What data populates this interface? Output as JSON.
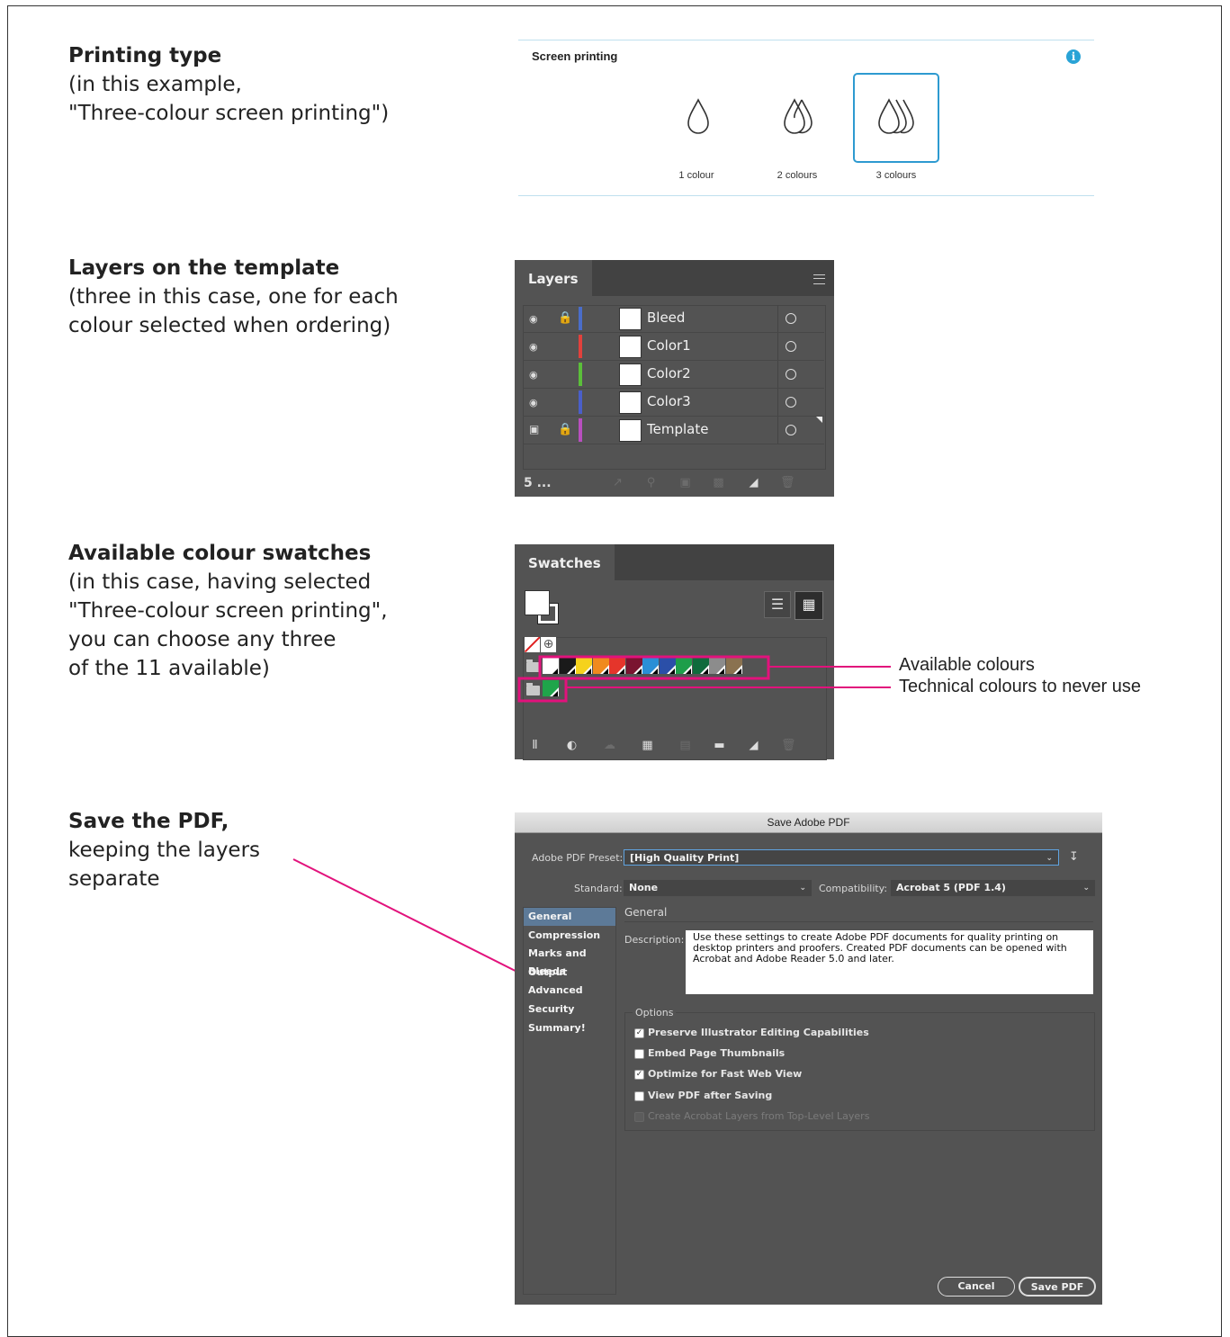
{
  "sections": [
    {
      "heading": "Printing type",
      "desc": "(in this example,\n\"Three-colour screen printing\")"
    },
    {
      "heading": "Layers on the template",
      "desc": "(three in this case, one for each\ncolour selected when ordering)"
    },
    {
      "heading": "Available colour swatches",
      "desc": "(in this case, having selected\n\"Three-colour screen printing\",\nyou can choose any three\nof the 11 available)"
    },
    {
      "heading": "Save the PDF,",
      "desc": "keeping the layers\nseparate"
    }
  ],
  "printing": {
    "title": "Screen printing",
    "info_icon": "i",
    "options": [
      {
        "label": "1 colour",
        "selected": false
      },
      {
        "label": "2 colours",
        "selected": false
      },
      {
        "label": "3 colours",
        "selected": true
      }
    ],
    "selection_color": "#2e9ad0"
  },
  "layers_panel": {
    "tab": "Layers",
    "count": "5 ...",
    "rows": [
      {
        "name": "Bleed",
        "color": "#4a6dc9",
        "visible": true,
        "locked": true
      },
      {
        "name": "Color1",
        "color": "#e2413c",
        "visible": true,
        "locked": false
      },
      {
        "name": "Color2",
        "color": "#5bbf3a",
        "visible": true,
        "locked": false
      },
      {
        "name": "Color3",
        "color": "#4a5fc9",
        "visible": true,
        "locked": false
      },
      {
        "name": "Template",
        "color": "#b84fbf",
        "visible": true,
        "locked": true
      }
    ]
  },
  "swatches_panel": {
    "tab": "Swatches",
    "available_colors": [
      "#ffffff",
      "#1a1a1a",
      "#f5d21c",
      "#f08a1e",
      "#e5352b",
      "#7a1430",
      "#2a8fd6",
      "#2b4fa8",
      "#1e9e4a",
      "#0f6b3c",
      "#8c8c8c",
      "#8a7250"
    ],
    "technical_colors": [
      "#1fa54a"
    ]
  },
  "annotations": {
    "available": "Available colours",
    "technical": "Technical colours to never use",
    "line_color": "#e2127c"
  },
  "dialog": {
    "title": "Save Adobe PDF",
    "preset_label": "Adobe PDF Preset:",
    "preset_value": "[High Quality Print]",
    "standard_label": "Standard:",
    "standard_value": "None",
    "compat_label": "Compatibility:",
    "compat_value": "Acrobat 5 (PDF 1.4)",
    "sidebar": [
      "General",
      "Compression",
      "Marks and Bleeds",
      "Output",
      "Advanced",
      "Security",
      "Summary!"
    ],
    "section_title": "General",
    "description_label": "Description:",
    "description": "Use these settings to create Adobe PDF documents for quality printing on desktop printers and proofers.  Created PDF documents can be opened with Acrobat and Adobe Reader 5.0 and later.",
    "options_title": "Options",
    "options": [
      {
        "label": "Preserve Illustrator Editing Capabilities",
        "checked": true,
        "enabled": true
      },
      {
        "label": "Embed Page Thumbnails",
        "checked": false,
        "enabled": true
      },
      {
        "label": "Optimize for Fast Web View",
        "checked": true,
        "enabled": true
      },
      {
        "label": "View PDF after Saving",
        "checked": false,
        "enabled": true
      },
      {
        "label": "Create Acrobat Layers from Top-Level Layers",
        "checked": false,
        "enabled": false
      }
    ],
    "cancel": "Cancel",
    "save": "Save PDF"
  }
}
